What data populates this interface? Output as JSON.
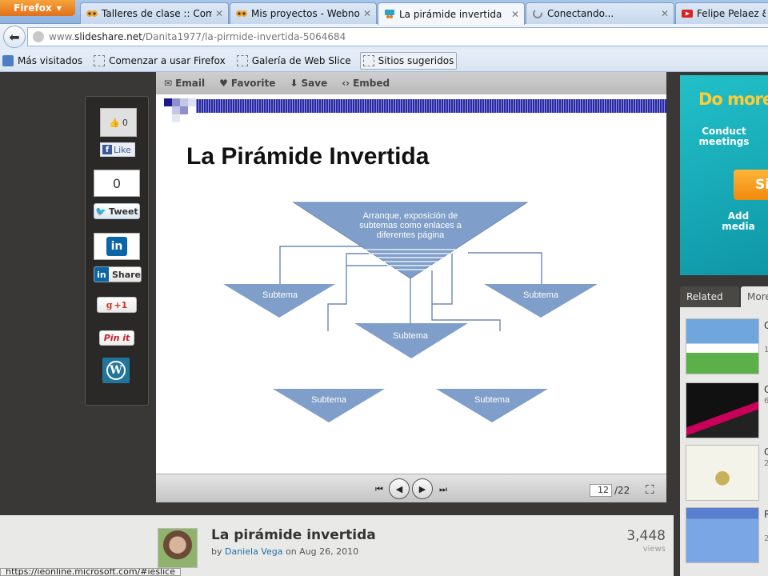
{
  "browser": {
    "menu_button": "Firefox",
    "tabs": [
      {
        "label": "Talleres de clase :: Comu...",
        "icon": "owl-favicon-icon"
      },
      {
        "label": "Mis proyectos - Webnode",
        "icon": "owl-favicon-icon"
      },
      {
        "label": "La pirámide invertida",
        "icon": "slideshare-favicon-icon",
        "active": true
      },
      {
        "label": "Conectando...",
        "icon": "loading-spinner-icon"
      },
      {
        "label": "Felipe Pelaez & M",
        "icon": "youtube-favicon-icon"
      }
    ],
    "url": {
      "prefix": "www.",
      "domain": "slideshare.net",
      "path": "/Danita1977/la-pirmide-invertida-5064684"
    },
    "bookmarks": [
      "Más visitados",
      "Comenzar a usar Firefox",
      "Galería de Web Slice",
      "Sitios sugeridos"
    ]
  },
  "share": {
    "fb_count": "0",
    "fb_like": "Like",
    "tweet_count": "0",
    "tweet": "Tweet",
    "linkedin_logo": "in",
    "linkedin_share": "Share",
    "gplus": "+1",
    "pinit": "Pin it",
    "wordpress": "W"
  },
  "toolbar": {
    "email": "Email",
    "favorite": "Favorite",
    "save": "Save",
    "embed": "Embed"
  },
  "slide": {
    "title": "La Pirámide Invertida",
    "top_text": [
      "Arranque, exposición de",
      "subtemas como enlaces a",
      "diferentes página"
    ],
    "subtema": "Subtema"
  },
  "player": {
    "current_page": "12",
    "total_pages": "/22"
  },
  "document": {
    "title": "La pirámide invertida",
    "by": "by",
    "author": "Daniela Vega",
    "date_prefix": "on",
    "date": "Aug 26, 2010",
    "views": "3,448",
    "views_label": "views"
  },
  "statusbar": "https://ieonline.microsoft.com/#ieslice",
  "ad": {
    "headline": "Do more",
    "line1": "Conduct meetings",
    "button": "Si",
    "line2": "Add media"
  },
  "related": {
    "tabs": [
      "Related",
      "More"
    ],
    "items": [
      {
        "letter": "C",
        "sub": "1"
      },
      {
        "letter": "C",
        "sub": "6"
      },
      {
        "letter": "C",
        "sub": "2"
      },
      {
        "letter": "R",
        "sub": "2"
      }
    ]
  },
  "colors": {
    "pyramid_fill": "#7f9ec9",
    "slide_stripe": "#2a2aa8",
    "ad_bg": "#17aab8"
  }
}
